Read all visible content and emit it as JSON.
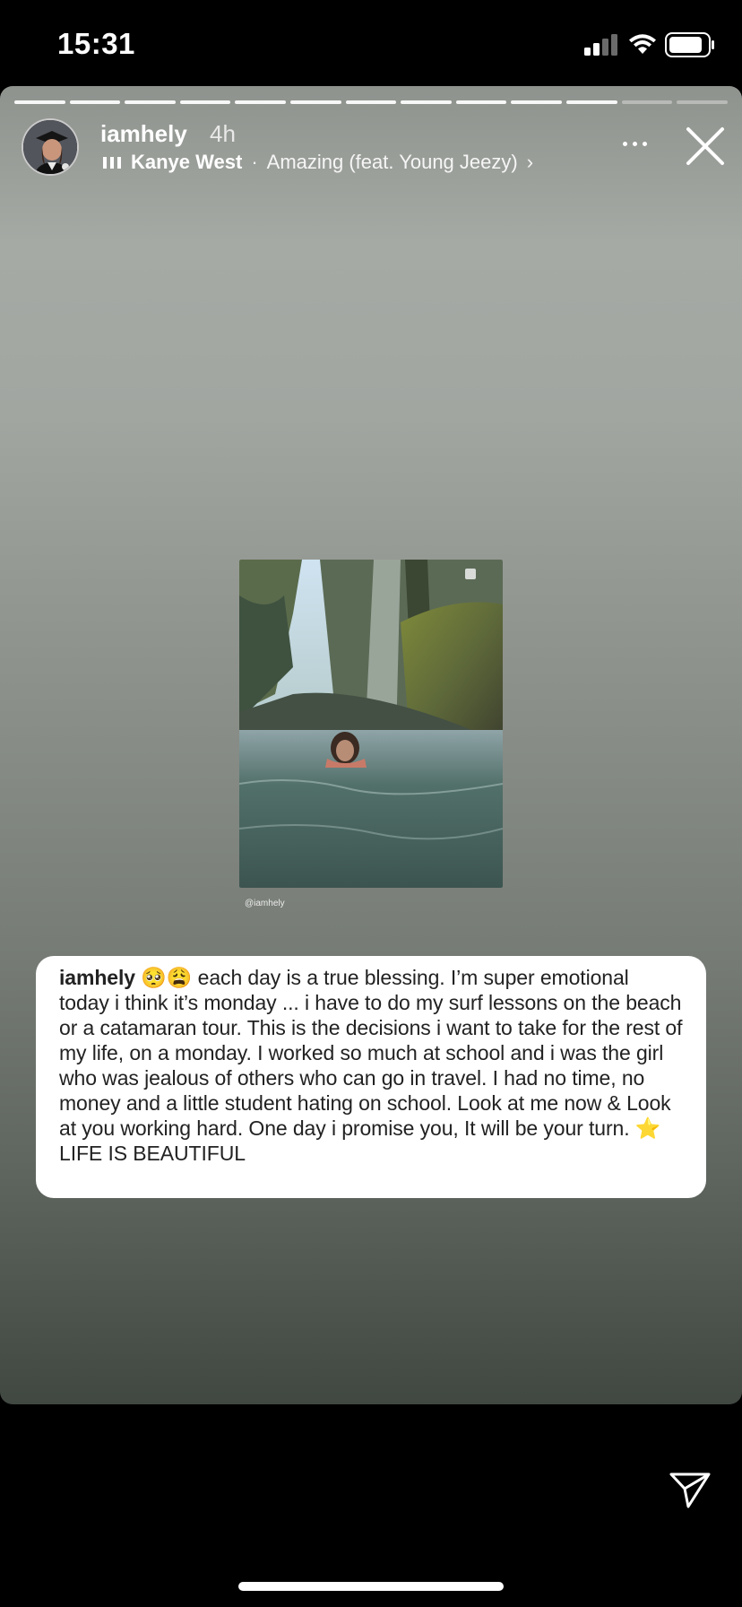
{
  "status_bar": {
    "time": "15:31",
    "signal_icon": "cellular-signal-icon",
    "wifi_icon": "wifi-icon",
    "battery_icon": "battery-icon"
  },
  "story": {
    "progress": {
      "total_segments": 13,
      "completed_segments": 11
    },
    "username": "iamhely",
    "time_ago": "4h",
    "music": {
      "icon": "music-bars-icon",
      "artist": "Kanye West",
      "separator": "·",
      "track": "Amazing (feat. Young Jeezy)",
      "chevron": "›"
    },
    "more_icon": "more-options-icon",
    "close_icon": "close-icon",
    "post": {
      "credit": "@iamhely",
      "badge_icon": "multiple-photos-icon"
    },
    "caption": {
      "username": "iamhely",
      "emoji_1": "🥺",
      "emoji_2": "😩",
      "text": "each day is a true blessing. I’m super emotional today i think it’s monday ... i have to do my surf lessons on the beach or a catamaran tour. This is the decisions i want to take for the rest of my life, on a monday. I worked so much at school and i was the girl who was jealous of others who can go in travel. I had no time, no money and a little student hating on school. Look at me now & Look at you working hard. One day i promise you, It will be your turn.",
      "star": "⭐",
      "closing": "LIFE IS BEAUTIFUL"
    }
  },
  "footer": {
    "send_icon": "send-paper-plane-icon"
  }
}
